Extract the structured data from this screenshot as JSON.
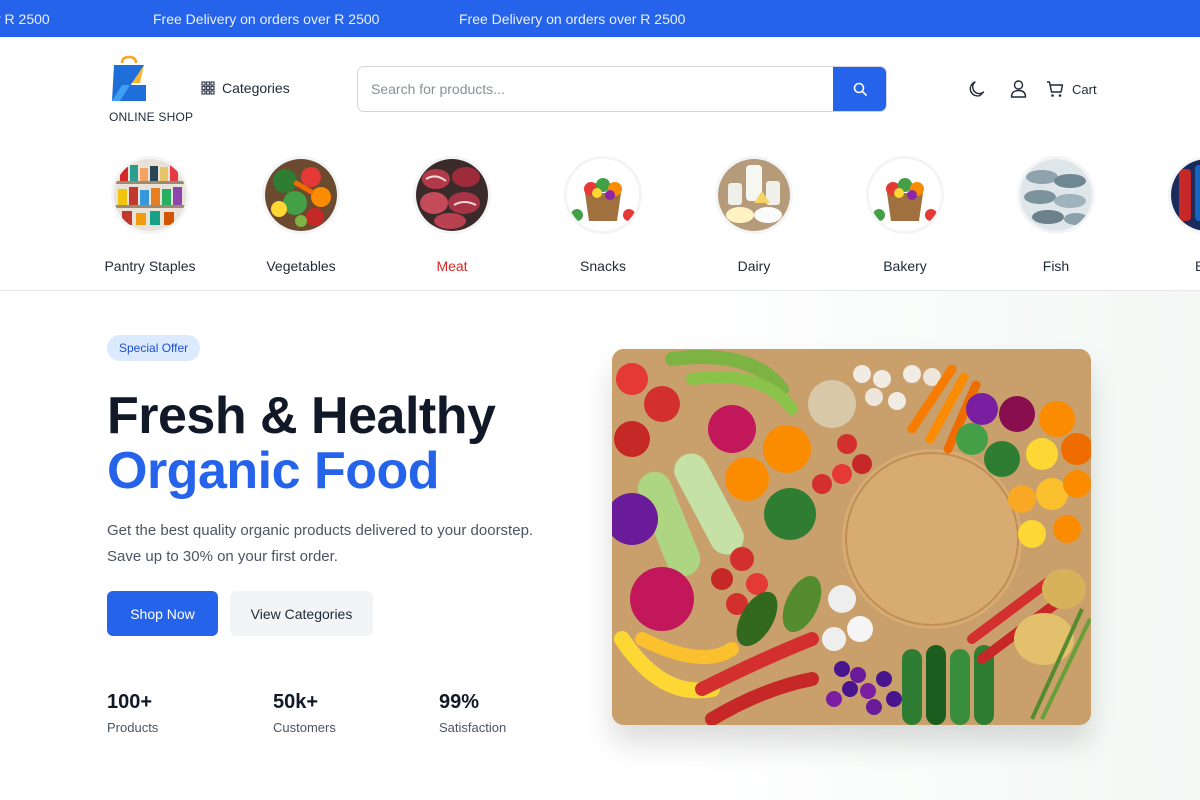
{
  "promo": {
    "messages": [
      "r R 2500",
      "Free Delivery on orders over R 2500",
      "Free Delivery on orders over R 2500"
    ]
  },
  "header": {
    "logo_text": "ONLINE SHOP",
    "categories_label": "Categories",
    "search_placeholder": "Search for products...",
    "cart_label": "Cart"
  },
  "categories": [
    {
      "label": "Pantry Staples",
      "active": false
    },
    {
      "label": "Vegetables",
      "active": false
    },
    {
      "label": "Meat",
      "active": true
    },
    {
      "label": "Snacks",
      "active": false
    },
    {
      "label": "Dairy",
      "active": false
    },
    {
      "label": "Bakery",
      "active": false
    },
    {
      "label": "Fish",
      "active": false
    },
    {
      "label": "Bev",
      "active": false
    }
  ],
  "hero": {
    "badge": "Special Offer",
    "title_line1": "Fresh & Healthy",
    "title_line2": "Organic Food",
    "description": "Get the best quality organic products delivered to your doorstep. Save up to 30% on your first order.",
    "primary_button": "Shop Now",
    "secondary_button": "View Categories",
    "stats": [
      {
        "value": "100+",
        "label": "Products"
      },
      {
        "value": "50k+",
        "label": "Customers"
      },
      {
        "value": "99%",
        "label": "Satisfaction"
      }
    ]
  },
  "colors": {
    "accent": "#2563eb",
    "active_category": "#dc2626"
  }
}
